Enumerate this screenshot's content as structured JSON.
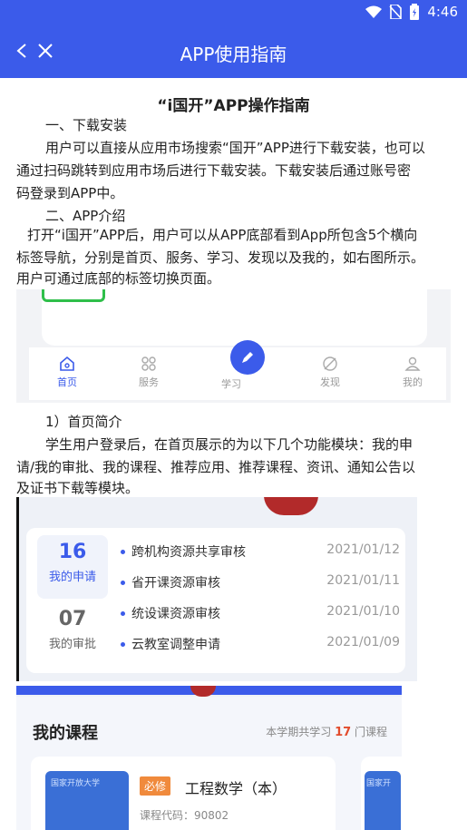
{
  "status": {
    "time": "4:46"
  },
  "nav": {
    "title": "APP使用指南"
  },
  "doc": {
    "title": "“i国开”APP操作指南",
    "s1_heading": "一、下载安装",
    "s1_body_l1": "用户可以直接从应用市场搜索“国开”APP进行下载安装，也可以",
    "s1_body_l2": "通过扫码跳转到应用市场后进行下载安装。下载安装后通过账号密",
    "s1_body_l3": "码登录到APP中。",
    "s2_heading": "二、APP介绍",
    "s2_body_l1": "打开“i国开”APP后，用户可以从APP底部看到App所包含5个横向",
    "s2_body_l2": "标签导航，分别是首页、服务、学习、发现以及我的，如右图所示。",
    "s2_body_l3": "用户可通过底部的标签切换页面。",
    "s3_heading": "1）首页简介",
    "s3_body_l1": "学生用户登录后，在首页展示的为以下几个功能模块：我的申",
    "s3_body_l2": "请/我的审批、我的课程、推荐应用、推荐课程、资讯、通知公告以",
    "s3_body_l3": "及证书下载等模块。"
  },
  "tabs": [
    {
      "label": "首页",
      "icon": "home-icon"
    },
    {
      "label": "服务",
      "icon": "grid-icon"
    },
    {
      "label": "学习",
      "icon": "pen-icon"
    },
    {
      "label": "发现",
      "icon": "compass-icon"
    },
    {
      "label": "我的",
      "icon": "user-icon"
    }
  ],
  "approvals": {
    "my_requests": {
      "count": "16",
      "label": "我的申请"
    },
    "my_approvals": {
      "count": "07",
      "label": "我的审批"
    },
    "items": [
      {
        "title": "跨机构资源共享审核",
        "date": "2021/01/12"
      },
      {
        "title": "省开课资源审核",
        "date": "2021/01/11"
      },
      {
        "title": "统设课资源审核",
        "date": "2021/01/10"
      },
      {
        "title": "云教室调整申请",
        "date": "2021/01/09"
      }
    ]
  },
  "courses": {
    "title": "我的课程",
    "summary_prefix": "本学期共学习",
    "count": "17",
    "summary_suffix": "门课程",
    "card": {
      "thumb_text": "国家开放大学",
      "tag": "必修",
      "name": "工程数学（本）",
      "code": "课程代码：90802"
    },
    "card2_thumb_text": "国家开"
  }
}
